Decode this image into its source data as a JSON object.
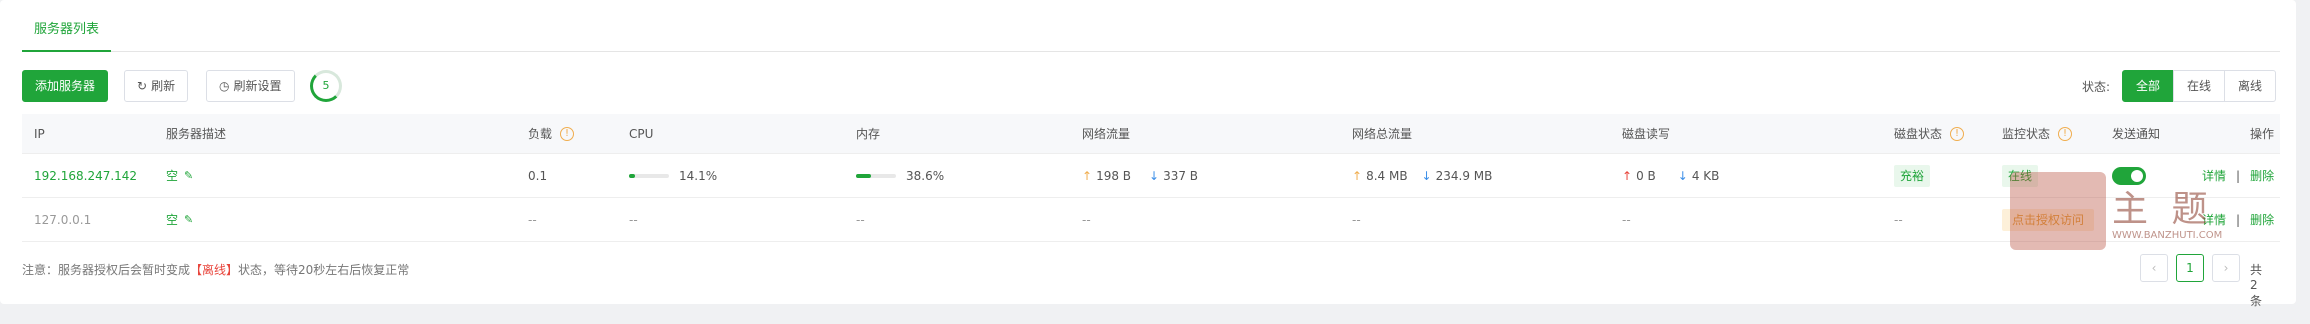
{
  "tabs": [
    {
      "label": "服务器列表"
    }
  ],
  "toolbar": {
    "add_label": "添加服务器",
    "refresh_label": "刷新",
    "refresh_settings_label": "刷新设置",
    "countdown": "5",
    "status_label": "状态:",
    "filters": [
      "全部",
      "在线",
      "离线"
    ],
    "active_filter": "全部"
  },
  "table": {
    "headers": {
      "ip": "IP",
      "desc": "服务器描述",
      "load": "负载",
      "cpu": "CPU",
      "mem": "内存",
      "net": "网络流量",
      "net_total": "网络总流量",
      "disk_io": "磁盘读写",
      "disk_status": "磁盘状态",
      "monitor_status": "监控状态",
      "notify": "发送通知",
      "actions": "操作"
    },
    "rows": [
      {
        "ip": "192.168.247.142",
        "desc": "空",
        "load": "0.1",
        "cpu": "14.1%",
        "cpu_percent": 14.1,
        "mem": "38.6%",
        "mem_percent": 38.6,
        "net_up": "198 B",
        "net_down": "337 B",
        "total_up": "8.4 MB",
        "total_down": "234.9 MB",
        "disk_read": "0 B",
        "disk_write": "4 KB",
        "disk_status": "充裕",
        "monitor_status": "在线",
        "notify_on": true,
        "action_detail": "详情",
        "action_sep": "|",
        "action_delete": "删除"
      },
      {
        "ip": "127.0.0.1",
        "desc": "空",
        "load": "--",
        "cpu": "--",
        "mem": "--",
        "net": "--",
        "net_total": "--",
        "disk_io": "--",
        "disk_status": "--",
        "monitor_status": "点击授权访问",
        "action_detail": "详情",
        "action_sep": "|",
        "action_delete": "删除"
      }
    ]
  },
  "footer": {
    "note_prefix": "注意：服务器授权后会暂时变成",
    "note_highlight": "【离线】",
    "note_suffix": "状态，等待20秒左右后恢复正常",
    "page_current": "1",
    "total": "共2条"
  },
  "watermark": {
    "big": "主 题",
    "small": "WWW.BANZHUTI.COM"
  },
  "colors": {
    "accent": "#20a53a",
    "warning": "#f0ad4e",
    "danger": "#e8453c"
  }
}
